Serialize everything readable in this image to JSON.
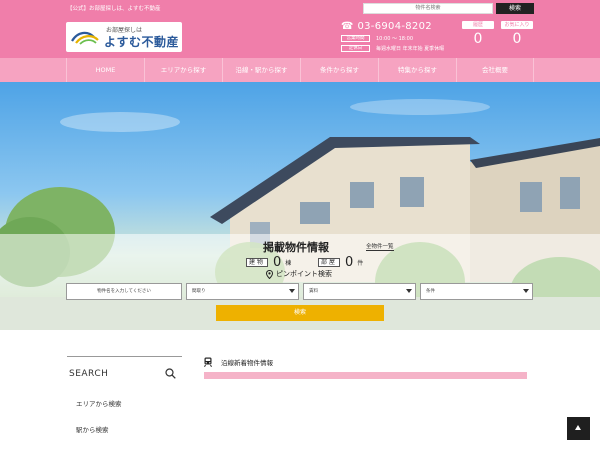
{
  "topbar": {
    "tagline": "【公式】お部屋探しは、よすむ不動産",
    "search_placeholder": "物件名検索",
    "search_button": "検索"
  },
  "header": {
    "logo_sub": "お部屋探しは",
    "logo_name": "よすむ不動産",
    "phone": "03-6904-8202",
    "hours_tag": "営業時間",
    "hours": "10:00 ～ 18:00",
    "closed_tag": "定休日",
    "closed": "毎週水曜日 年末年始 夏季休暇",
    "history_label": "履歴",
    "history_count": "0",
    "favorites_label": "お気に入り",
    "favorites_count": "0"
  },
  "nav": {
    "items": [
      "HOME",
      "エリアから探す",
      "沿線・駅から探す",
      "条件から探す",
      "特集から探す",
      "会社概要"
    ]
  },
  "listing": {
    "title": "掲載物件情報",
    "all_link": "全物件一覧",
    "buildings_tag": "建物",
    "buildings_value": "0",
    "buildings_unit": "棟",
    "rooms_tag": "部屋",
    "rooms_value": "0",
    "rooms_unit": "件",
    "pinpoint": "ピンポイント検索"
  },
  "search_form": {
    "keyword_placeholder": "物件名を入力してください",
    "layout_select": "間取り",
    "rent_select": "賃料",
    "condition_select": "条件",
    "submit": "検索"
  },
  "sidebar": {
    "heading": "SEARCH",
    "links": [
      "エリアから検索",
      "駅から検索"
    ]
  },
  "main": {
    "new_heading": "沿線新着物件情報"
  },
  "colors": {
    "header_pink": "#f07eaa",
    "nav_pink": "#f6a3c1",
    "button_yellow": "#eeb100",
    "bar_pink": "#f5b3c8"
  },
  "icons": [
    "phone-icon",
    "pin-icon",
    "search-icon",
    "train-icon",
    "arrow-up-icon"
  ]
}
